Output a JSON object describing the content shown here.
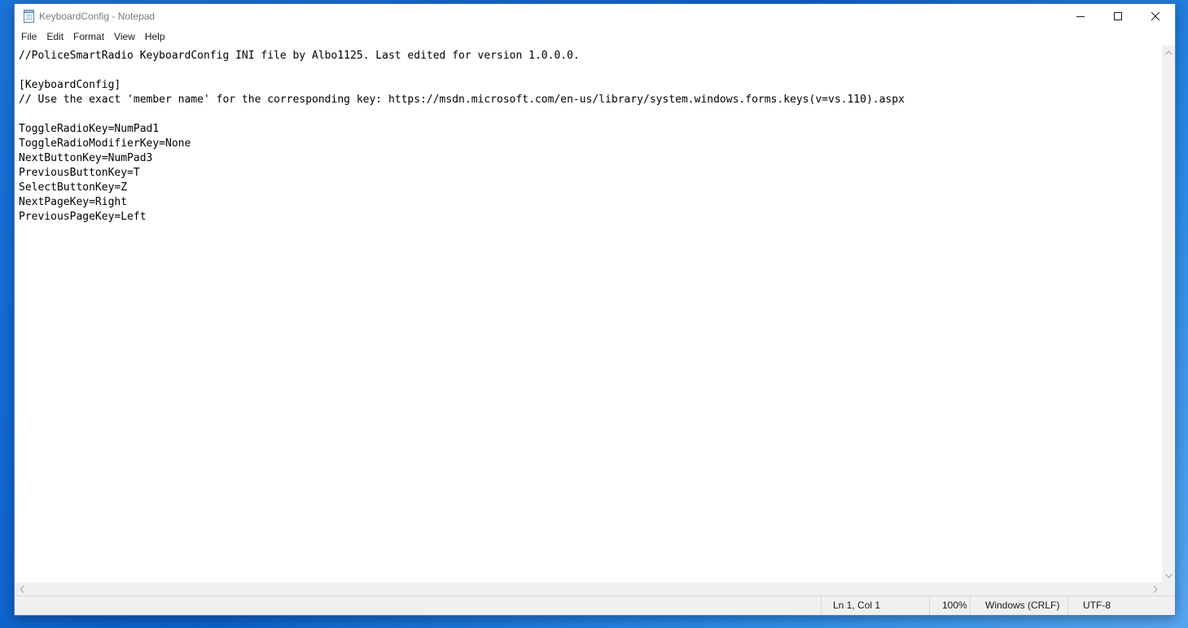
{
  "window": {
    "title": "KeyboardConfig - Notepad"
  },
  "menu": {
    "items": [
      "File",
      "Edit",
      "Format",
      "View",
      "Help"
    ]
  },
  "editor": {
    "lines": [
      "//PoliceSmartRadio KeyboardConfig INI file by Albo1125. Last edited for version 1.0.0.0.",
      "",
      "[KeyboardConfig]",
      "// Use the exact 'member name' for the corresponding key: https://msdn.microsoft.com/en-us/library/system.windows.forms.keys(v=vs.110).aspx",
      "",
      "ToggleRadioKey=NumPad1",
      "ToggleRadioModifierKey=None",
      "NextButtonKey=NumPad3",
      "PreviousButtonKey=T",
      "SelectButtonKey=Z",
      "NextPageKey=Right",
      "PreviousPageKey=Left"
    ]
  },
  "status": {
    "position": "Ln 1, Col 1",
    "zoom": "100%",
    "line_ending": "Windows (CRLF)",
    "encoding": "UTF-8"
  },
  "icons": {
    "app": "notepad-icon",
    "minimize": "minimize-icon",
    "maximize": "maximize-icon",
    "close": "close-icon"
  },
  "colors": {
    "desktop": "#1a73d6",
    "title_text": "#7a7a7a",
    "statusbar": "#f0f0f0"
  }
}
